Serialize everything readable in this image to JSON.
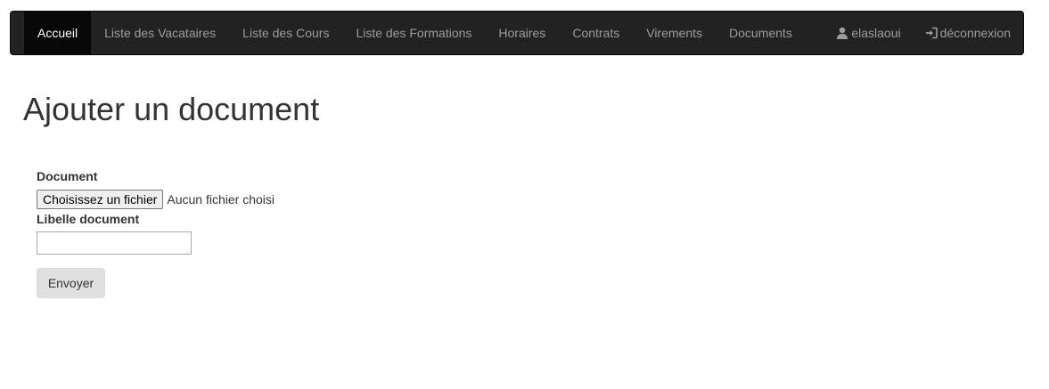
{
  "navbar": {
    "items": [
      {
        "label": "Accueil",
        "active": true
      },
      {
        "label": "Liste des Vacataires",
        "active": false
      },
      {
        "label": "Liste des Cours",
        "active": false
      },
      {
        "label": "Liste des Formations",
        "active": false
      },
      {
        "label": "Horaires",
        "active": false
      },
      {
        "label": "Contrats",
        "active": false
      },
      {
        "label": "Virements",
        "active": false
      },
      {
        "label": "Documents",
        "active": false
      }
    ],
    "user": {
      "label": "elaslaoui",
      "icon": "user-icon"
    },
    "logout": {
      "label": "déconnexion",
      "icon": "sign-in-icon"
    }
  },
  "page": {
    "title": "Ajouter un document"
  },
  "form": {
    "document_label": "Document",
    "file_button_label": "Choisissez un fichier",
    "file_status": "Aucun fichier choisi",
    "libelle_label": "Libelle document",
    "libelle_value": "",
    "submit_label": "Envoyer"
  },
  "colors": {
    "navbar_bg": "#222222",
    "navbar_active_bg": "#080808",
    "nav_text": "#9d9d9d",
    "nav_active_text": "#ffffff"
  }
}
